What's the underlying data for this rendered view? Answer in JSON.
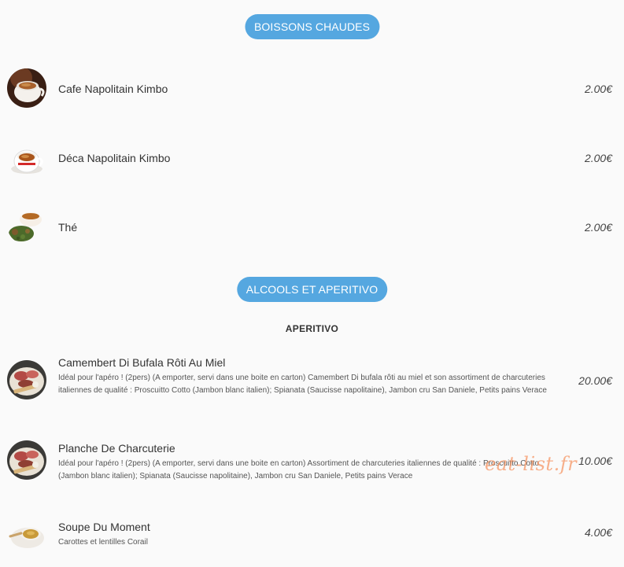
{
  "sections": [
    {
      "title": "BOISSONS CHAUDES",
      "items": [
        {
          "name": "Cafe Napolitain Kimbo",
          "price": "2.00€",
          "image_icon": "espresso-cup-icon"
        },
        {
          "name": "Déca Napolitain Kimbo",
          "price": "2.00€",
          "image_icon": "espresso-cup-icon"
        },
        {
          "name": "Thé",
          "price": "2.00€",
          "image_icon": "tea-cup-icon"
        }
      ]
    },
    {
      "title": "ALCOOLS ET APERITIVO",
      "subtitle": "APERITIVO",
      "items": [
        {
          "name": "Camembert Di Bufala Rôti Au Miel",
          "description": "Idéal pour l'apéro ! (2pers) (A emporter, servi dans une boite en carton) Camembert Di bufala rôti au miel et son assortiment de charcuteries italiennes de qualité : Proscuitto Cotto (Jambon blanc italien); Spianata (Saucisse napolitaine), Jambon cru San Daniele, Petits pains Verace",
          "price": "20.00€",
          "image_icon": "charcuterie-plate-icon"
        },
        {
          "name": "Planche De Charcuterie",
          "description": "Idéal pour l'apéro ! (2pers) (A emporter, servi dans une boite en carton) Assortiment de charcuteries italiennes de qualité : Proscuitto Cotto (Jambon blanc italien); Spianata (Saucisse napolitaine), Jambon cru San Daniele, Petits pains Verace",
          "price": "10.00€",
          "image_icon": "charcuterie-plate-icon"
        },
        {
          "name": "Soupe Du Moment",
          "description": "Carottes et lentilles Corail",
          "price": "4.00€",
          "image_icon": "soup-bowl-icon"
        }
      ]
    }
  ],
  "watermark": "eat-list.fr",
  "colors": {
    "accent": "#55a7e0",
    "background": "#fafafa",
    "watermark": "#f59664"
  }
}
